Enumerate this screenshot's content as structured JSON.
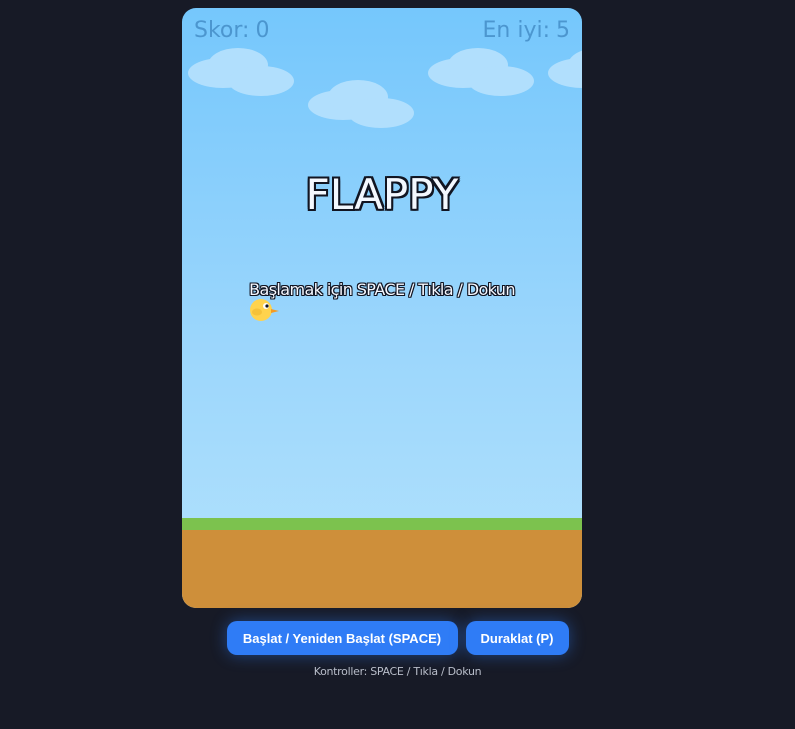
{
  "hud": {
    "score_label": "Skor:",
    "score_value": "0",
    "best_label": "En iyi:",
    "best_value": "5"
  },
  "overlay": {
    "title": "FLAPPY",
    "subtitle": "Başlamak için SPACE / Tıkla / Dokun"
  },
  "controls": {
    "start_label": "Başlat / Yeniden Başlat (SPACE)",
    "pause_label": "Duraklat (P)",
    "hint": "Kontroller: SPACE / Tıkla / Dokun"
  },
  "colors": {
    "background": "#171a26",
    "sky_top": "#75c7fc",
    "sky_bottom": "#b3e2fd",
    "grass": "#7cc24e",
    "ground": "#ce8f3a",
    "button": "#2f7cf6",
    "bird": "#ffd34d"
  }
}
